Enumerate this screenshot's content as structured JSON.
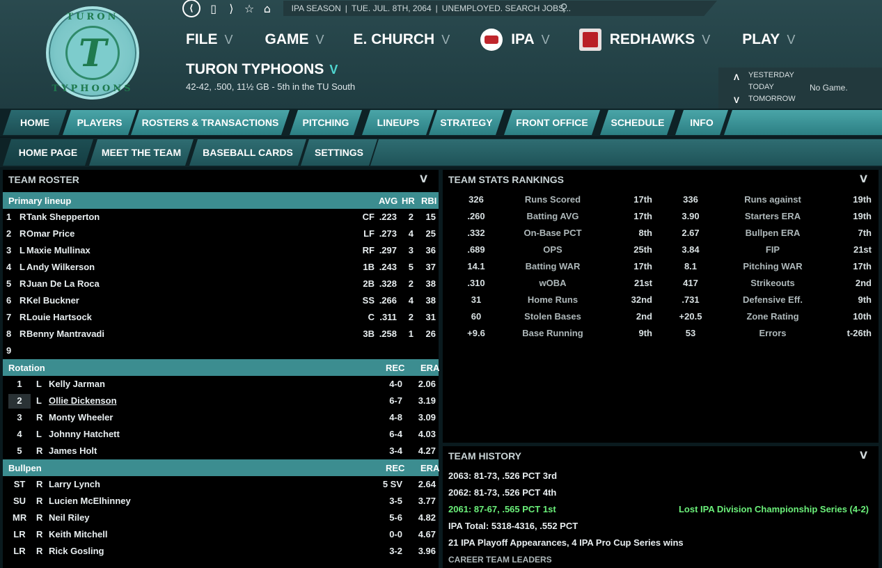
{
  "header": {
    "logo": {
      "top_text": "TURON",
      "letter": "T",
      "bottom_text": "TYPHOONS"
    },
    "status": {
      "season": "IPA SEASON",
      "date": "TUE. JUL. 8TH, 2064",
      "message": "UNEMPLOYED. SEARCH JOBS..."
    },
    "menu": [
      {
        "label": "FILE"
      },
      {
        "label": "GAME"
      },
      {
        "label": "E. CHURCH"
      },
      {
        "label": "IPA"
      },
      {
        "label": "REDHAWKS"
      },
      {
        "label": "PLAY"
      }
    ],
    "team_name": "TURON TYPHOONS",
    "team_record": "42-42, .500, 11½ GB - 5th in the TU South",
    "days": {
      "yesterday": "YESTERDAY",
      "today": "TODAY",
      "tomorrow": "TOMORROW",
      "today_value": "No Game."
    }
  },
  "tabs": [
    {
      "label": "HOME"
    },
    {
      "label": "PLAYERS"
    },
    {
      "label": "ROSTERS & TRANSACTIONS"
    },
    {
      "label": "PITCHING"
    },
    {
      "label": "LINEUPS"
    },
    {
      "label": "STRATEGY"
    },
    {
      "label": "FRONT OFFICE"
    },
    {
      "label": "SCHEDULE"
    },
    {
      "label": "INFO"
    }
  ],
  "subtabs": [
    {
      "label": "HOME PAGE"
    },
    {
      "label": "MEET THE TEAM"
    },
    {
      "label": "BASEBALL CARDS"
    },
    {
      "label": "SETTINGS"
    }
  ],
  "roster": {
    "title": "TEAM ROSTER",
    "lineup_header": {
      "label": "Primary lineup",
      "avg": "AVG",
      "hr": "HR",
      "rbi": "RBI"
    },
    "lineup": [
      {
        "n": "1",
        "hand": "R",
        "name": "Tank Shepperton",
        "pos": "CF",
        "avg": ".223",
        "hr": "2",
        "rbi": "15"
      },
      {
        "n": "2",
        "hand": "R",
        "name": "Omar Price",
        "pos": "LF",
        "avg": ".273",
        "hr": "4",
        "rbi": "25"
      },
      {
        "n": "3",
        "hand": "L",
        "name": "Maxie Mullinax",
        "pos": "RF",
        "avg": ".297",
        "hr": "3",
        "rbi": "36"
      },
      {
        "n": "4",
        "hand": "L",
        "name": "Andy Wilkerson",
        "pos": "1B",
        "avg": ".243",
        "hr": "5",
        "rbi": "37"
      },
      {
        "n": "5",
        "hand": "R",
        "name": "Juan De La Roca",
        "pos": "2B",
        "avg": ".328",
        "hr": "2",
        "rbi": "38"
      },
      {
        "n": "6",
        "hand": "R",
        "name": "Kel Buckner",
        "pos": "SS",
        "avg": ".266",
        "hr": "4",
        "rbi": "38"
      },
      {
        "n": "7",
        "hand": "R",
        "name": "Louie Hartsock",
        "pos": "C",
        "avg": ".311",
        "hr": "2",
        "rbi": "31"
      },
      {
        "n": "8",
        "hand": "R",
        "name": "Benny Mantravadi",
        "pos": "3B",
        "avg": ".258",
        "hr": "1",
        "rbi": "26"
      },
      {
        "n": "9",
        "hand": "",
        "name": "",
        "pos": "",
        "avg": "",
        "hr": "",
        "rbi": ""
      }
    ],
    "rotation_header": {
      "label": "Rotation",
      "rec": "REC",
      "era": "ERA"
    },
    "rotation": [
      {
        "n": "1",
        "hand": "L",
        "name": "Kelly Jarman",
        "rec": "4-0",
        "era": "2.06"
      },
      {
        "n": "2",
        "hand": "L",
        "name": "Ollie Dickenson",
        "rec": "6-7",
        "era": "3.19"
      },
      {
        "n": "3",
        "hand": "R",
        "name": "Monty Wheeler",
        "rec": "4-8",
        "era": "3.09"
      },
      {
        "n": "4",
        "hand": "L",
        "name": "Johnny Hatchett",
        "rec": "6-4",
        "era": "4.03"
      },
      {
        "n": "5",
        "hand": "R",
        "name": "James Holt",
        "rec": "3-4",
        "era": "4.27"
      }
    ],
    "bullpen_header": {
      "label": "Bullpen",
      "rec": "REC",
      "era": "ERA"
    },
    "bullpen": [
      {
        "n": "ST",
        "hand": "R",
        "name": "Larry Lynch",
        "rec": "5 SV",
        "era": "2.64"
      },
      {
        "n": "SU",
        "hand": "R",
        "name": "Lucien McElhinney",
        "rec": "3-5",
        "era": "3.77"
      },
      {
        "n": "MR",
        "hand": "R",
        "name": "Neil Riley",
        "rec": "5-6",
        "era": "4.82"
      },
      {
        "n": "LR",
        "hand": "R",
        "name": "Keith Mitchell",
        "rec": "0-0",
        "era": "4.67"
      },
      {
        "n": "LR",
        "hand": "R",
        "name": "Rick Gosling",
        "rec": "3-2",
        "era": "3.96"
      }
    ]
  },
  "rankings": {
    "title": "TEAM STATS RANKINGS",
    "rows": [
      {
        "v1": "326",
        "l1": "Runs Scored",
        "r1": "17th",
        "v2": "336",
        "l2": "Runs against",
        "r2": "19th"
      },
      {
        "v1": ".260",
        "l1": "Batting AVG",
        "r1": "17th",
        "v2": "3.90",
        "l2": "Starters ERA",
        "r2": "19th"
      },
      {
        "v1": ".332",
        "l1": "On-Base PCT",
        "r1": "8th",
        "v2": "2.67",
        "l2": "Bullpen ERA",
        "r2": "7th"
      },
      {
        "v1": ".689",
        "l1": "OPS",
        "r1": "25th",
        "v2": "3.84",
        "l2": "FIP",
        "r2": "21st"
      },
      {
        "v1": "14.1",
        "l1": "Batting WAR",
        "r1": "17th",
        "v2": "8.1",
        "l2": "Pitching WAR",
        "r2": "17th"
      },
      {
        "v1": ".310",
        "l1": "wOBA",
        "r1": "21st",
        "v2": "417",
        "l2": "Strikeouts",
        "r2": "2nd"
      },
      {
        "v1": "31",
        "l1": "Home Runs",
        "r1": "32nd",
        "v2": ".731",
        "l2": "Defensive Eff.",
        "r2": "9th"
      },
      {
        "v1": "60",
        "l1": "Stolen Bases",
        "r1": "2nd",
        "v2": "+20.5",
        "l2": "Zone Rating",
        "r2": "10th"
      },
      {
        "v1": "+9.6",
        "l1": "Base Running",
        "r1": "9th",
        "v2": "53",
        "l2": "Errors",
        "r2": "t-26th"
      }
    ]
  },
  "history": {
    "title": "TEAM HISTORY",
    "lines": [
      "2063: 81-73, .526 PCT 3rd",
      "2062: 81-73, .526 PCT 4th",
      "2061: 87-67, .565 PCT 1st"
    ],
    "highlight_note": "Lost IPA Division Championship Series (4-2)",
    "total": "IPA Total: 5318-4316, .552 PCT",
    "playoffs": "21 IPA Playoff Appearances, 4 IPA Pro Cup Series wins",
    "leaders": "CAREER TEAM LEADERS"
  }
}
